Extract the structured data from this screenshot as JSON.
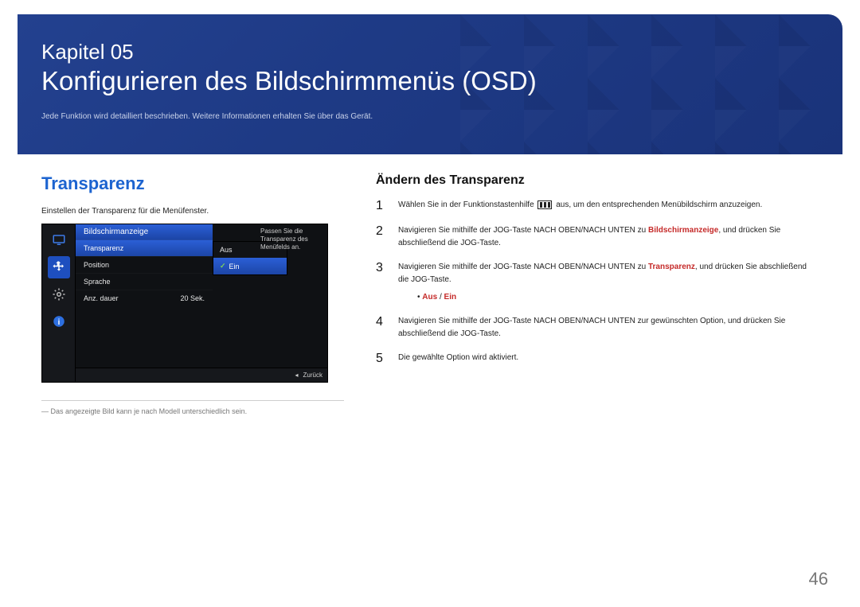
{
  "banner": {
    "chapter": "Kapitel 05",
    "title": "Konfigurieren des Bildschirmmenüs (OSD)",
    "subtitle": "Jede Funktion wird detailliert beschrieben. Weitere Informationen erhalten Sie über das Gerät."
  },
  "left": {
    "heading": "Transparenz",
    "desc": "Einstellen der Transparenz für die Menüfenster.",
    "footnote": "Das angezeigte Bild kann je nach Modell unterschiedlich sein."
  },
  "osd": {
    "header": "Bildschirmanzeige",
    "rows": [
      {
        "label": "Transparenz",
        "value": "",
        "selected": true
      },
      {
        "label": "Position",
        "value": ""
      },
      {
        "label": "Sprache",
        "value": ""
      },
      {
        "label": "Anz. dauer",
        "value": "20 Sek."
      }
    ],
    "options": [
      {
        "label": "Aus",
        "selected": false
      },
      {
        "label": "Ein",
        "selected": true
      }
    ],
    "tip": "Passen Sie die Transparenz des Menüfelds an.",
    "back": "Zurück"
  },
  "right": {
    "heading": "Ändern des Transparenz",
    "steps": {
      "s1_a": "Wählen Sie in der Funktionstastenhilfe ",
      "s1_b": " aus, um den entsprechenden Menübildschirm anzuzeigen.",
      "s2_a": "Navigieren Sie mithilfe der JOG-Taste NACH OBEN/NACH UNTEN zu ",
      "s2_red": "Bildschirmanzeige",
      "s2_b": ", und drücken Sie abschließend die JOG-Taste.",
      "s3_a": "Navigieren Sie mithilfe der JOG-Taste NACH OBEN/NACH UNTEN zu ",
      "s3_red": "Transparenz",
      "s3_b": ", und drücken Sie abschließend die JOG-Taste.",
      "bullet_a": "Aus",
      "bullet_sep": " / ",
      "bullet_b": "Ein",
      "s4": "Navigieren Sie mithilfe der JOG-Taste NACH OBEN/NACH UNTEN zur gewünschten Option, und drücken Sie abschließend die JOG-Taste.",
      "s5": "Die gewählte Option wird aktiviert."
    }
  },
  "pageNumber": "46"
}
